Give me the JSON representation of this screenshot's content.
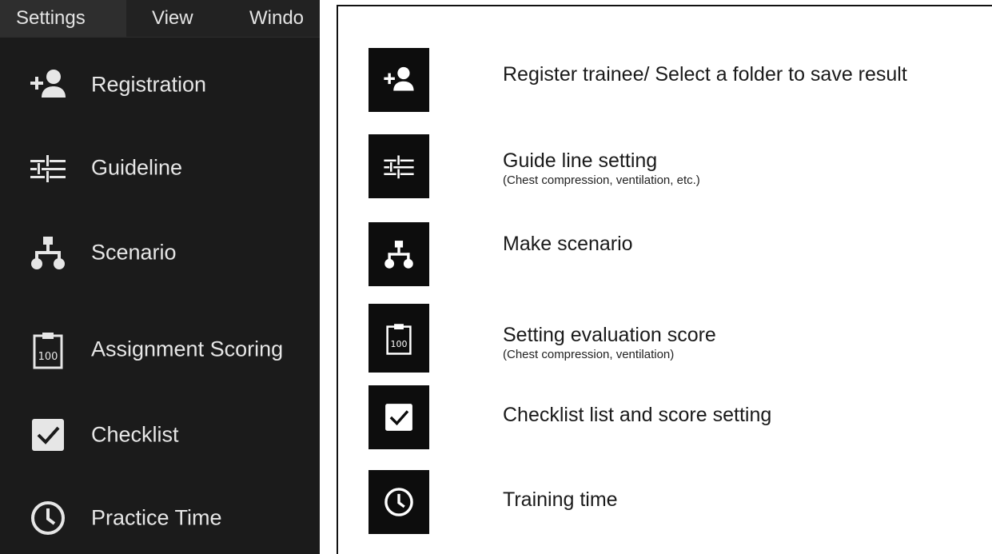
{
  "menubar": {
    "settings": "Settings",
    "view": "View",
    "window": "Windo"
  },
  "menu": {
    "items": [
      {
        "label": "Registration",
        "icon": "add-person-icon"
      },
      {
        "label": "Guideline",
        "icon": "sliders-icon"
      },
      {
        "label": "Scenario",
        "icon": "hierarchy-icon"
      },
      {
        "label": "Assignment Scoring",
        "icon": "clipboard-100-icon"
      },
      {
        "label": "Checklist",
        "icon": "checkbox-icon"
      },
      {
        "label": "Practice Time",
        "icon": "clock-icon"
      }
    ]
  },
  "legend": {
    "items": [
      {
        "title": "Register trainee/ Select a folder to save result",
        "sub": "",
        "icon": "add-person-icon"
      },
      {
        "title": "Guide line setting",
        "sub": "(Chest compression, ventilation, etc.)",
        "icon": "sliders-icon"
      },
      {
        "title": "Make scenario",
        "sub": "",
        "icon": "hierarchy-icon"
      },
      {
        "title": "Setting evaluation score",
        "sub": "(Chest compression, ventilation)",
        "icon": "clipboard-100-icon"
      },
      {
        "title": "Checklist list and score setting",
        "sub": "",
        "icon": "checkbox-icon"
      },
      {
        "title": "Training time",
        "sub": "",
        "icon": "clock-icon"
      }
    ],
    "clipboard_number": "100"
  },
  "colors": {
    "panel_bg": "#1b1b1b",
    "menubar_active_bg": "#2e2e2e",
    "menu_text": "#e6e6e6",
    "icon_box_bg": "#0d0d0d",
    "legend_text": "#1a1a1a"
  }
}
